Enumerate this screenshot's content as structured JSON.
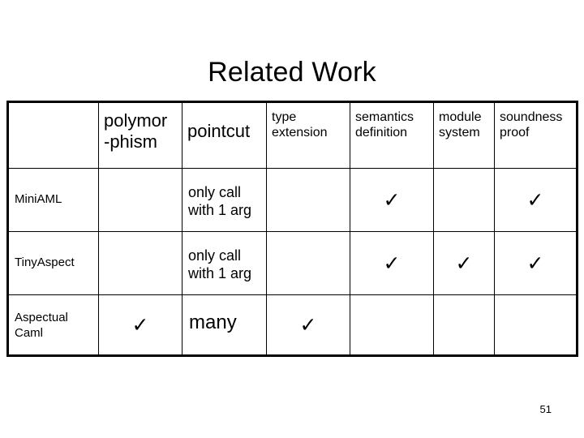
{
  "slide": {
    "title": "Related Work",
    "page_number": "51"
  },
  "table": {
    "headers": [
      "",
      "polymor\n-phism",
      "pointcut",
      "type\nextension",
      "semantics\ndefinition",
      "module\nsystem",
      "soundness\nproof"
    ],
    "header_lines": {
      "polymorphism_line1": "polymor",
      "polymorphism_line2": "-phism",
      "pointcut": "pointcut",
      "type_extension_line1": "type",
      "type_extension_line2": "extension",
      "semantics_definition_line1": "semantics",
      "semantics_definition_line2": "definition",
      "module_system_line1": "module",
      "module_system_line2": "system",
      "soundness_proof_line1": "soundness",
      "soundness_proof_line2": "proof"
    },
    "check_glyph": "✓",
    "rows": [
      {
        "label": "MiniAML",
        "label_line1": "MiniAML",
        "label_line2": "",
        "polymorphism": "",
        "pointcut_line1": "only call",
        "pointcut_line2": "with 1 arg",
        "type_extension": "",
        "semantics_definition": "✓",
        "module_system": "",
        "soundness_proof": "✓"
      },
      {
        "label": "TinyAspect",
        "label_line1": "TinyAspect",
        "label_line2": "",
        "polymorphism": "",
        "pointcut_line1": "only call",
        "pointcut_line2": "with 1 arg",
        "type_extension": "",
        "semantics_definition": "✓",
        "module_system": "✓",
        "soundness_proof": "✓"
      },
      {
        "label": "Aspectual Caml",
        "label_line1": "Aspectual",
        "label_line2": "Caml",
        "polymorphism": "✓",
        "pointcut_line1": "many",
        "pointcut_line2": "",
        "type_extension": "✓",
        "semantics_definition": "",
        "module_system": "",
        "soundness_proof": ""
      }
    ]
  },
  "colors": {
    "background": "#ffffff",
    "text": "#000000",
    "border": "#000000"
  }
}
